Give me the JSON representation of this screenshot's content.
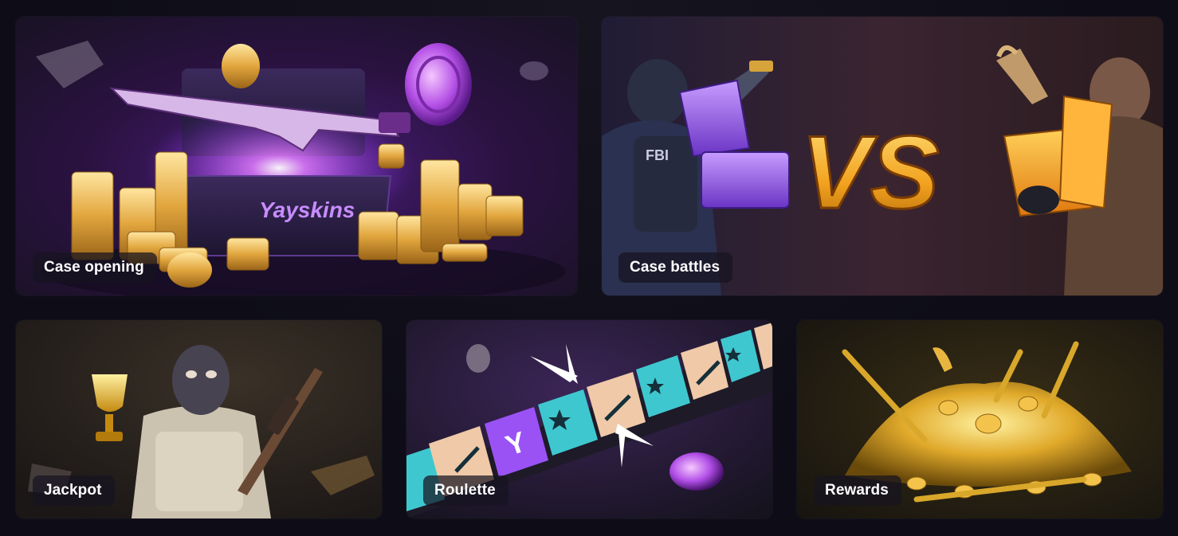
{
  "modes": [
    {
      "id": "case-opening",
      "label": "Case opening",
      "brand_text": "Yayskins"
    },
    {
      "id": "case-battles",
      "label": "Case battles",
      "vs_text": "VS",
      "badge_text": "FBI"
    },
    {
      "id": "jackpot",
      "label": "Jackpot"
    },
    {
      "id": "roulette",
      "label": "Roulette",
      "tile_letter": "Y"
    },
    {
      "id": "rewards",
      "label": "Rewards"
    }
  ],
  "colors": {
    "background": "#0e0d17",
    "purple_glow": "#b13cff",
    "gold": "#f0b52e",
    "teal_tile": "#3fc7cf",
    "beige_tile": "#efc9a8",
    "purple_tile": "#9a52f5"
  },
  "icons": [
    "coin-icon",
    "rifle-icon",
    "knife-icon",
    "trophy-icon",
    "crate-icon",
    "star-icon",
    "pointer-icon"
  ]
}
